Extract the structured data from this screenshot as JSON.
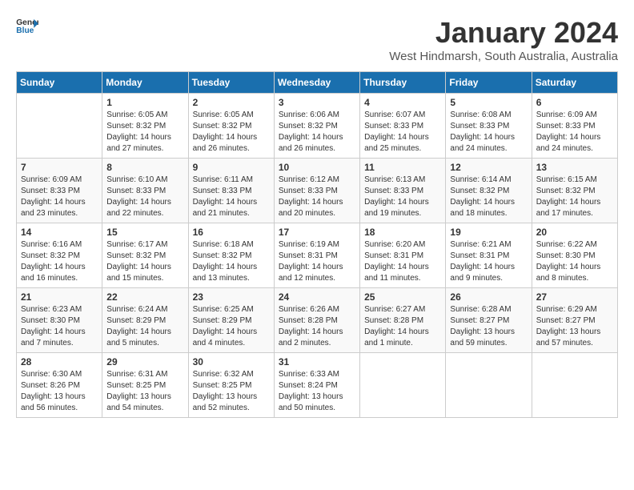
{
  "logo": {
    "text_general": "General",
    "text_blue": "Blue"
  },
  "title": "January 2024",
  "subtitle": "West Hindmarsh, South Australia, Australia",
  "days_of_week": [
    "Sunday",
    "Monday",
    "Tuesday",
    "Wednesday",
    "Thursday",
    "Friday",
    "Saturday"
  ],
  "weeks": [
    [
      {
        "day": "",
        "info": ""
      },
      {
        "day": "1",
        "info": "Sunrise: 6:05 AM\nSunset: 8:32 PM\nDaylight: 14 hours\nand 27 minutes."
      },
      {
        "day": "2",
        "info": "Sunrise: 6:05 AM\nSunset: 8:32 PM\nDaylight: 14 hours\nand 26 minutes."
      },
      {
        "day": "3",
        "info": "Sunrise: 6:06 AM\nSunset: 8:32 PM\nDaylight: 14 hours\nand 26 minutes."
      },
      {
        "day": "4",
        "info": "Sunrise: 6:07 AM\nSunset: 8:33 PM\nDaylight: 14 hours\nand 25 minutes."
      },
      {
        "day": "5",
        "info": "Sunrise: 6:08 AM\nSunset: 8:33 PM\nDaylight: 14 hours\nand 24 minutes."
      },
      {
        "day": "6",
        "info": "Sunrise: 6:09 AM\nSunset: 8:33 PM\nDaylight: 14 hours\nand 24 minutes."
      }
    ],
    [
      {
        "day": "7",
        "info": "Sunrise: 6:09 AM\nSunset: 8:33 PM\nDaylight: 14 hours\nand 23 minutes."
      },
      {
        "day": "8",
        "info": "Sunrise: 6:10 AM\nSunset: 8:33 PM\nDaylight: 14 hours\nand 22 minutes."
      },
      {
        "day": "9",
        "info": "Sunrise: 6:11 AM\nSunset: 8:33 PM\nDaylight: 14 hours\nand 21 minutes."
      },
      {
        "day": "10",
        "info": "Sunrise: 6:12 AM\nSunset: 8:33 PM\nDaylight: 14 hours\nand 20 minutes."
      },
      {
        "day": "11",
        "info": "Sunrise: 6:13 AM\nSunset: 8:33 PM\nDaylight: 14 hours\nand 19 minutes."
      },
      {
        "day": "12",
        "info": "Sunrise: 6:14 AM\nSunset: 8:32 PM\nDaylight: 14 hours\nand 18 minutes."
      },
      {
        "day": "13",
        "info": "Sunrise: 6:15 AM\nSunset: 8:32 PM\nDaylight: 14 hours\nand 17 minutes."
      }
    ],
    [
      {
        "day": "14",
        "info": "Sunrise: 6:16 AM\nSunset: 8:32 PM\nDaylight: 14 hours\nand 16 minutes."
      },
      {
        "day": "15",
        "info": "Sunrise: 6:17 AM\nSunset: 8:32 PM\nDaylight: 14 hours\nand 15 minutes."
      },
      {
        "day": "16",
        "info": "Sunrise: 6:18 AM\nSunset: 8:32 PM\nDaylight: 14 hours\nand 13 minutes."
      },
      {
        "day": "17",
        "info": "Sunrise: 6:19 AM\nSunset: 8:31 PM\nDaylight: 14 hours\nand 12 minutes."
      },
      {
        "day": "18",
        "info": "Sunrise: 6:20 AM\nSunset: 8:31 PM\nDaylight: 14 hours\nand 11 minutes."
      },
      {
        "day": "19",
        "info": "Sunrise: 6:21 AM\nSunset: 8:31 PM\nDaylight: 14 hours\nand 9 minutes."
      },
      {
        "day": "20",
        "info": "Sunrise: 6:22 AM\nSunset: 8:30 PM\nDaylight: 14 hours\nand 8 minutes."
      }
    ],
    [
      {
        "day": "21",
        "info": "Sunrise: 6:23 AM\nSunset: 8:30 PM\nDaylight: 14 hours\nand 7 minutes."
      },
      {
        "day": "22",
        "info": "Sunrise: 6:24 AM\nSunset: 8:29 PM\nDaylight: 14 hours\nand 5 minutes."
      },
      {
        "day": "23",
        "info": "Sunrise: 6:25 AM\nSunset: 8:29 PM\nDaylight: 14 hours\nand 4 minutes."
      },
      {
        "day": "24",
        "info": "Sunrise: 6:26 AM\nSunset: 8:28 PM\nDaylight: 14 hours\nand 2 minutes."
      },
      {
        "day": "25",
        "info": "Sunrise: 6:27 AM\nSunset: 8:28 PM\nDaylight: 14 hours\nand 1 minute."
      },
      {
        "day": "26",
        "info": "Sunrise: 6:28 AM\nSunset: 8:27 PM\nDaylight: 13 hours\nand 59 minutes."
      },
      {
        "day": "27",
        "info": "Sunrise: 6:29 AM\nSunset: 8:27 PM\nDaylight: 13 hours\nand 57 minutes."
      }
    ],
    [
      {
        "day": "28",
        "info": "Sunrise: 6:30 AM\nSunset: 8:26 PM\nDaylight: 13 hours\nand 56 minutes."
      },
      {
        "day": "29",
        "info": "Sunrise: 6:31 AM\nSunset: 8:25 PM\nDaylight: 13 hours\nand 54 minutes."
      },
      {
        "day": "30",
        "info": "Sunrise: 6:32 AM\nSunset: 8:25 PM\nDaylight: 13 hours\nand 52 minutes."
      },
      {
        "day": "31",
        "info": "Sunrise: 6:33 AM\nSunset: 8:24 PM\nDaylight: 13 hours\nand 50 minutes."
      },
      {
        "day": "",
        "info": ""
      },
      {
        "day": "",
        "info": ""
      },
      {
        "day": "",
        "info": ""
      }
    ]
  ]
}
